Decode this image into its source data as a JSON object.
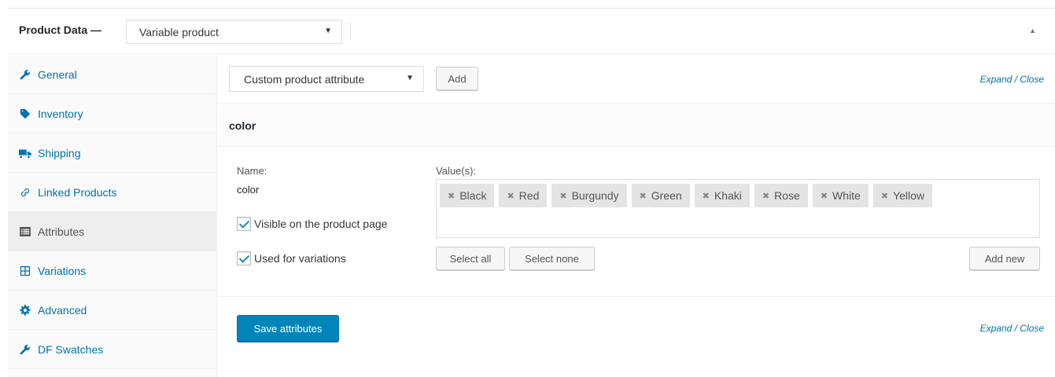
{
  "header": {
    "title": "Product Data —",
    "product_type": "Variable product",
    "collapse_icon": "triangle-up-icon"
  },
  "sidebar": {
    "items": [
      {
        "label": "General",
        "icon": "wrench-icon",
        "active": false
      },
      {
        "label": "Inventory",
        "icon": "tag-icon",
        "active": false
      },
      {
        "label": "Shipping",
        "icon": "truck-icon",
        "active": false
      },
      {
        "label": "Linked Products",
        "icon": "link-icon",
        "active": false
      },
      {
        "label": "Attributes",
        "icon": "list-icon",
        "active": true
      },
      {
        "label": "Variations",
        "icon": "grid-icon",
        "active": false
      },
      {
        "label": "Advanced",
        "icon": "gear-icon",
        "active": false
      },
      {
        "label": "DF Swatches",
        "icon": "wrench-icon",
        "active": false
      }
    ]
  },
  "toolbar": {
    "attribute_select": "Custom product attribute",
    "add_label": "Add",
    "expand_close": "Expand / Close"
  },
  "attribute": {
    "title": "color",
    "name_label": "Name:",
    "name_value": "color",
    "values_label": "Value(s):",
    "visible_label": "Visible on the product page",
    "visible_checked": true,
    "variations_label": "Used for variations",
    "variations_checked": true,
    "values": [
      "Black",
      "Red",
      "Burgundy",
      "Green",
      "Khaki",
      "Rose",
      "White",
      "Yellow"
    ],
    "select_all": "Select all",
    "select_none": "Select none",
    "add_new": "Add new"
  },
  "footer": {
    "save_label": "Save attributes",
    "expand_close": "Expand / Close"
  },
  "colors": {
    "link": "#0073aa",
    "primary_button": "#0085ba",
    "active_tab_bg": "#eeeeee",
    "chip_bg": "#e4e4e4"
  }
}
